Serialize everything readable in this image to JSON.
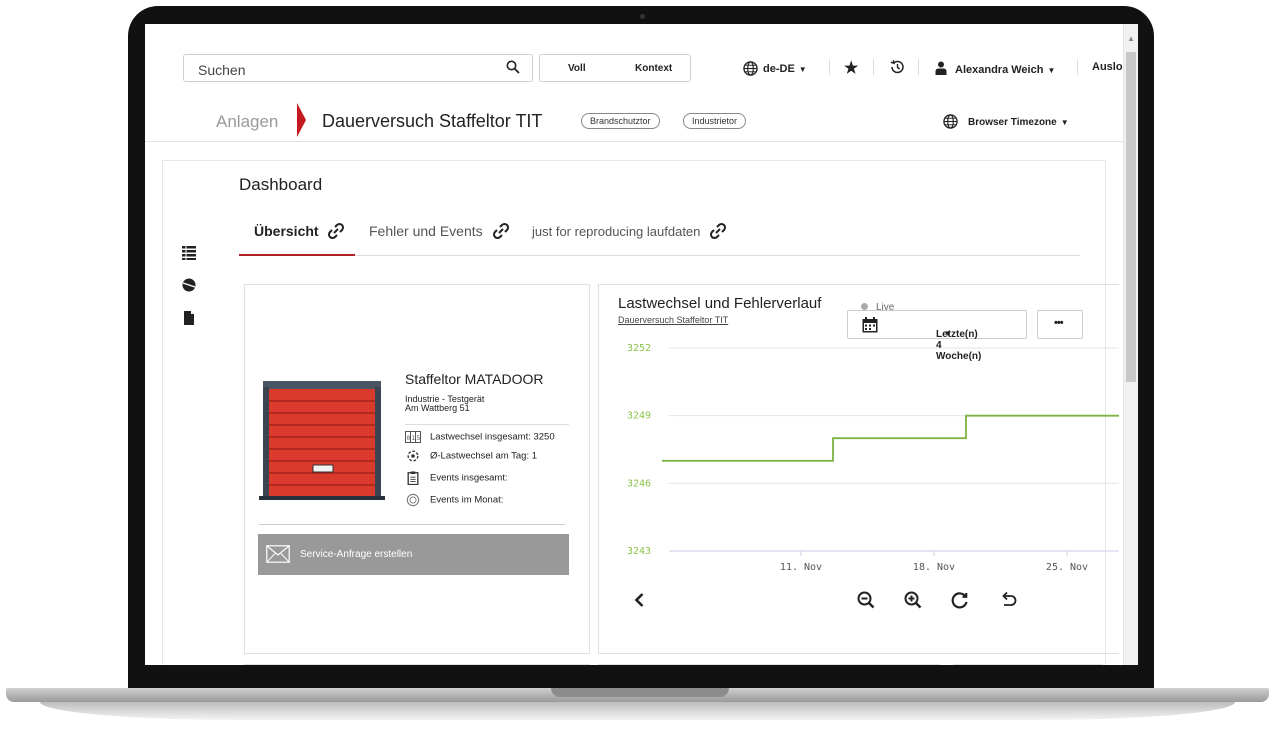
{
  "header": {
    "search_placeholder": "Suchen",
    "mode_full": "Voll",
    "mode_context": "Kontext",
    "language": "de-DE",
    "user": "Alexandra Weich",
    "logout": "Auslo"
  },
  "breadcrumb": {
    "root": "Anlagen",
    "current": "Dauerversuch Staffeltor TIT",
    "tags": [
      "Brandschutztor",
      "Industrietor"
    ],
    "timezone": "Browser Timezone"
  },
  "dashboard": {
    "title": "Dashboard",
    "tabs": [
      {
        "label": "Übersicht",
        "active": true
      },
      {
        "label": "Fehler und Events",
        "active": false
      },
      {
        "label": "just for reproducing laufdaten",
        "active": false
      }
    ]
  },
  "device": {
    "name": "Staffeltor MATADOOR",
    "type": "Industrie - Testgerät",
    "address": "Am Wattberg 51",
    "stats": [
      "Lastwechsel insgesamt: 3250",
      "Ø-Lastwechsel am Tag: 1",
      "Events insgesamt:",
      "Events im Monat:"
    ],
    "service_button": "Service-Anfrage erstellen"
  },
  "chart_panel": {
    "title": "Lastwechsel und Fehlerverlauf",
    "subtitle": "Dauerversuch Staffeltor TIT",
    "live_label": "Live",
    "range_label": "Letzte(n) 4 Woche(n)",
    "more_label": "•••"
  },
  "colors": {
    "accent_red": "#b11e25",
    "series_green": "#7cb342",
    "axis_label_green": "#8bc34a"
  },
  "chart_data": {
    "type": "line",
    "step": true,
    "title": "Lastwechsel und Fehlerverlauf",
    "xlabel": "",
    "ylabel": "",
    "ylim": [
      3243,
      3252
    ],
    "yticks": [
      3243,
      3246,
      3249,
      3252
    ],
    "xticks": [
      "11. Nov",
      "18. Nov",
      "25. Nov"
    ],
    "grid": true,
    "series": [
      {
        "x": [
          "2019-11-05",
          "2019-11-14",
          "2019-11-14",
          "2019-11-21",
          "2019-11-21",
          "2019-11-27"
        ],
        "values": [
          3247,
          3247,
          3248,
          3248,
          3249,
          3249
        ]
      }
    ]
  }
}
